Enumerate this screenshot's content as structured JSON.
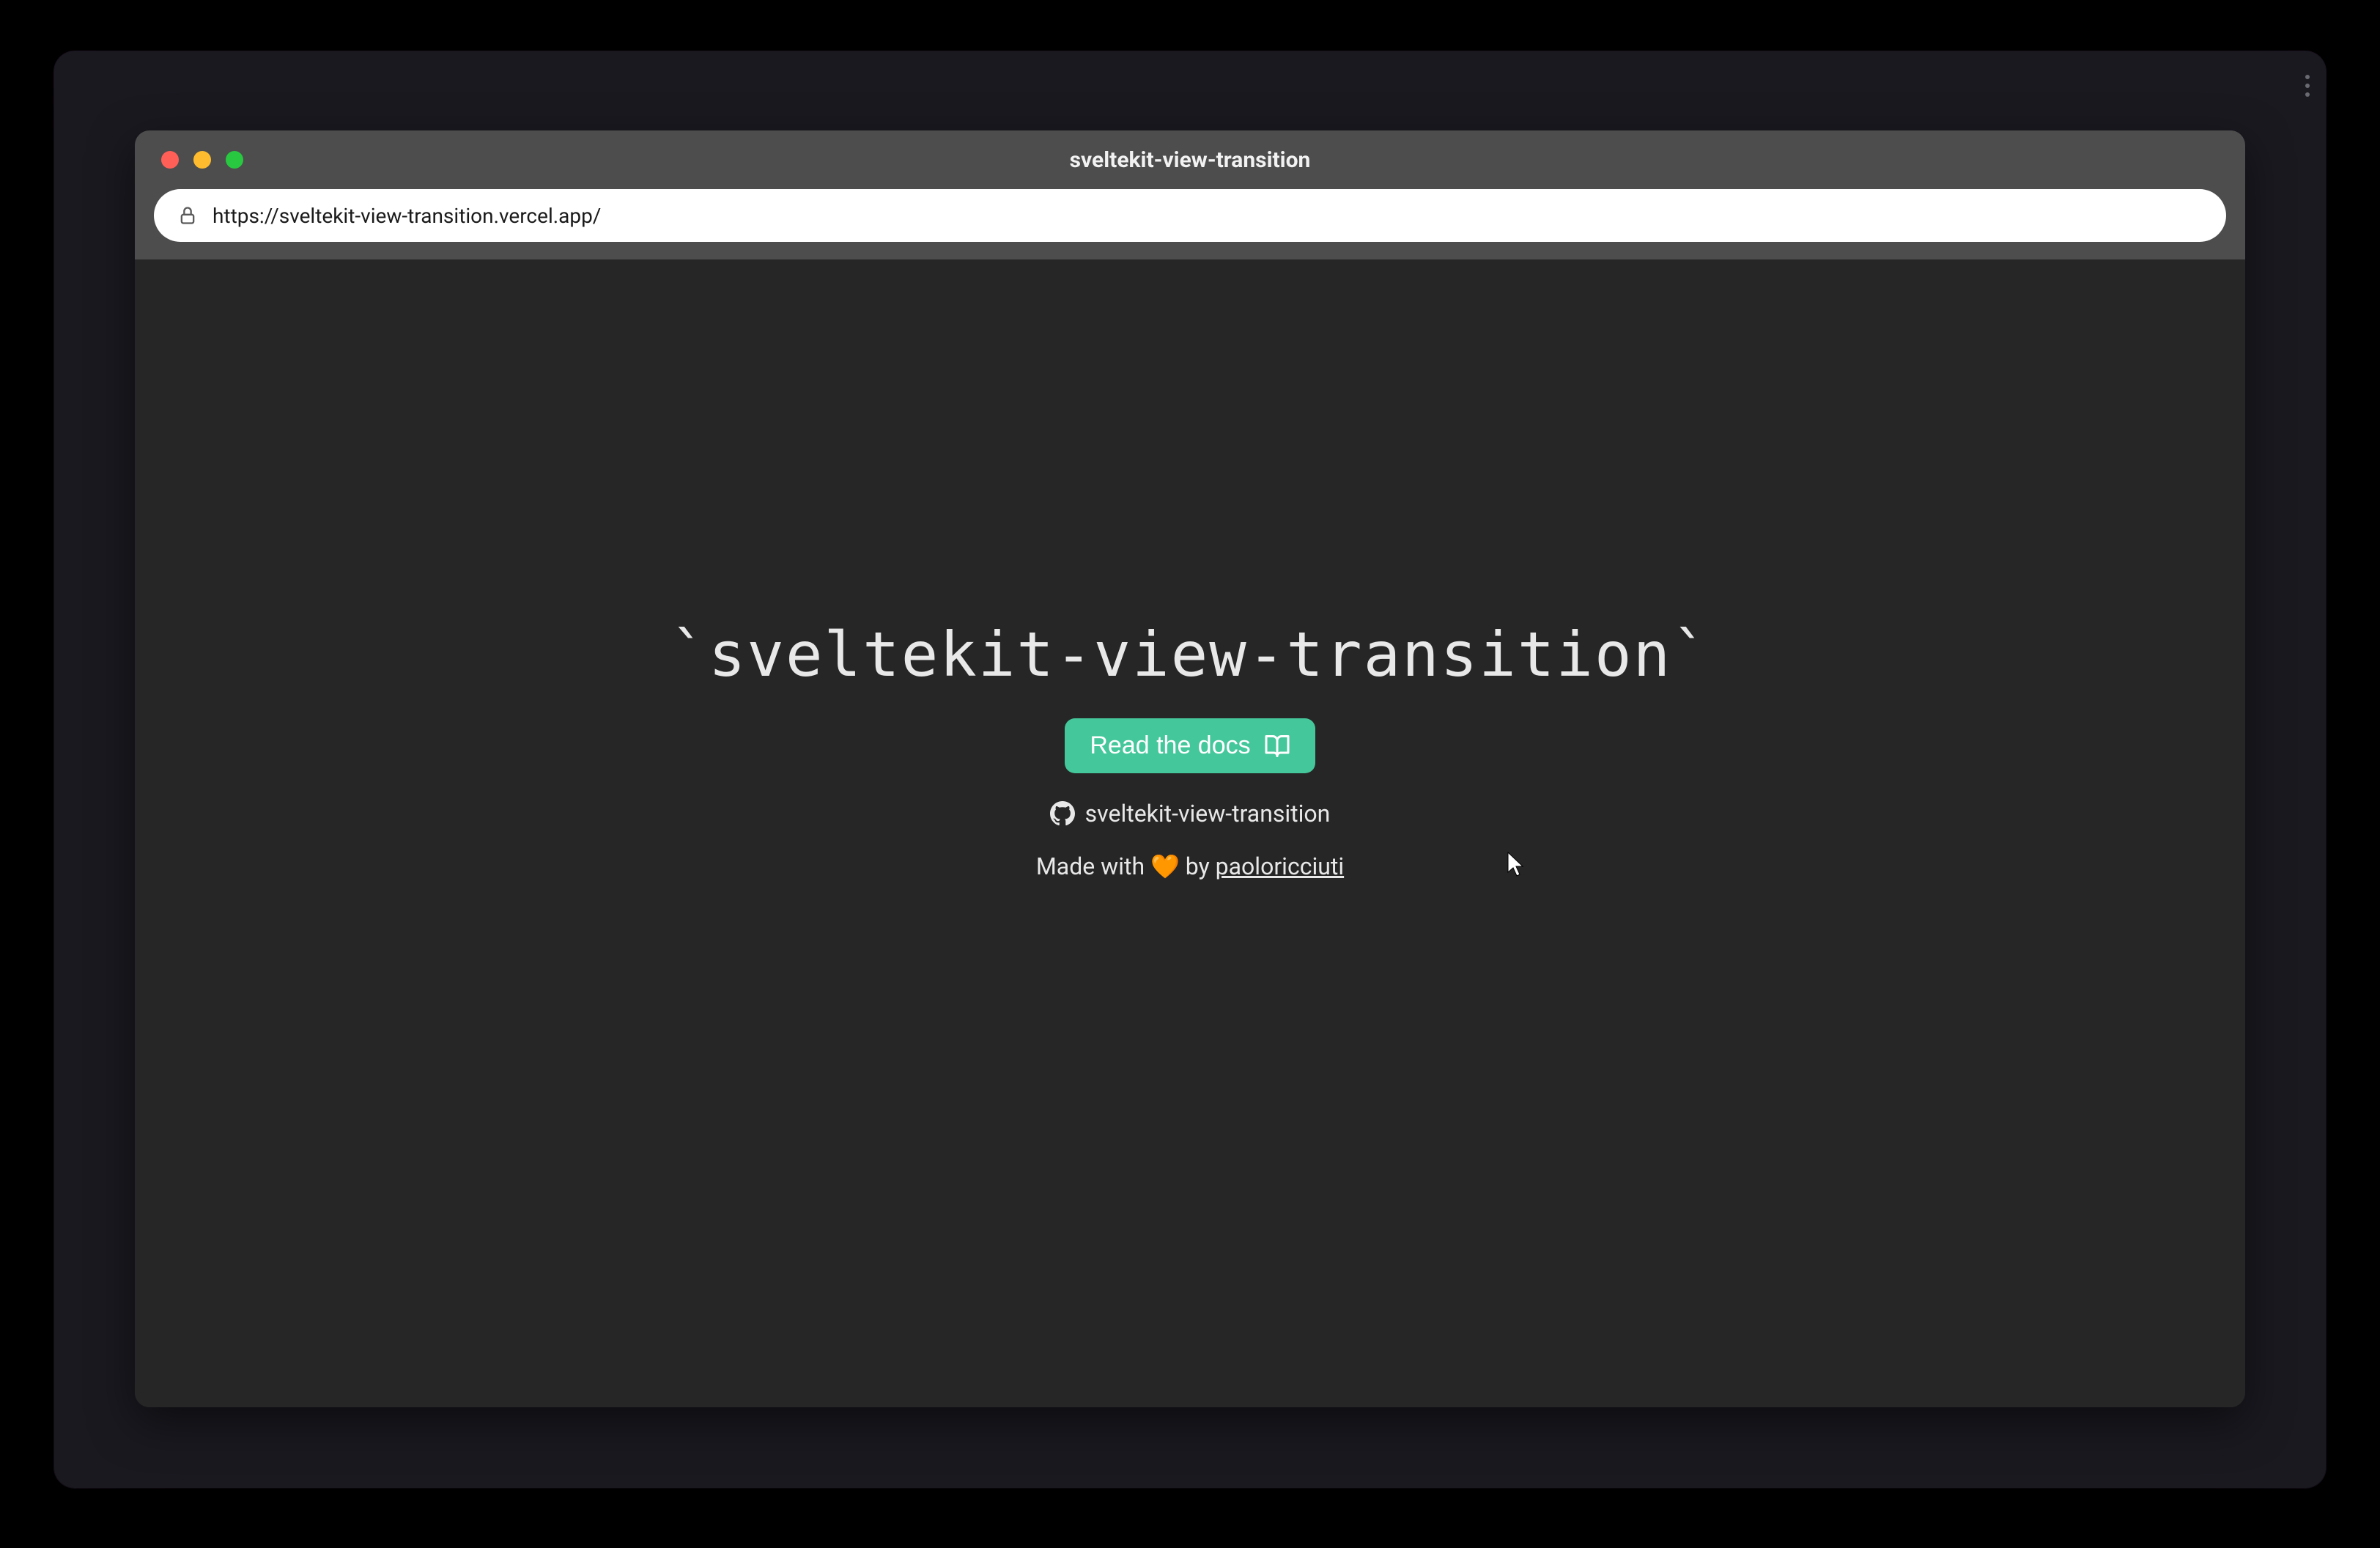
{
  "browser": {
    "title": "sveltekit-view-transition",
    "url": "https://sveltekit-view-transition.vercel.app/"
  },
  "page": {
    "heading": "`sveltekit-view-transition`",
    "docs_button_label": "Read the docs",
    "github_link_label": "sveltekit-view-transition",
    "made_with_prefix": "Made with ",
    "made_with_heart": "🧡",
    "made_with_by": " by ",
    "author": "paoloricciuti"
  },
  "colors": {
    "window_bg": "#1a1920",
    "titlebar_bg": "#4d4d4d",
    "page_bg": "#262626",
    "accent_button": "#44c79b",
    "text_light": "#e8e8e8"
  }
}
